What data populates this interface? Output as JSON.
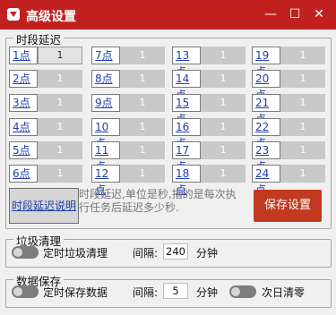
{
  "window": {
    "title": "高级设置",
    "min_symbol": "—",
    "max_symbol": "☐",
    "close_symbol": "✕"
  },
  "delay_group": {
    "legend": "时段延迟",
    "hours": [
      {
        "label": "1点",
        "value": "1"
      },
      {
        "label": "2点",
        "value": "1"
      },
      {
        "label": "3点",
        "value": "1"
      },
      {
        "label": "4点",
        "value": "1"
      },
      {
        "label": "5点",
        "value": "1"
      },
      {
        "label": "6点",
        "value": "1"
      },
      {
        "label": "7点",
        "value": "1"
      },
      {
        "label": "8点",
        "value": "1"
      },
      {
        "label": "9点",
        "value": "1"
      },
      {
        "label": "10点",
        "value": "1"
      },
      {
        "label": "11点",
        "value": "1"
      },
      {
        "label": "12点",
        "value": "1"
      },
      {
        "label": "13点",
        "value": "1"
      },
      {
        "label": "14点",
        "value": "1"
      },
      {
        "label": "15点",
        "value": "1"
      },
      {
        "label": "16点",
        "value": "1"
      },
      {
        "label": "17点",
        "value": "1"
      },
      {
        "label": "18点",
        "value": "1"
      },
      {
        "label": "19点",
        "value": "1"
      },
      {
        "label": "20点",
        "value": "1"
      },
      {
        "label": "21点",
        "value": "1"
      },
      {
        "label": "22点",
        "value": "1"
      },
      {
        "label": "23点",
        "value": "1"
      },
      {
        "label": "24点",
        "value": "1"
      }
    ],
    "explain_button": "时段延迟说明",
    "explain_text": "时段延迟,单位是秒,指的是每次执行任务后延迟多少秒.",
    "save_button": "保存设置"
  },
  "trash_group": {
    "legend": "垃圾清理",
    "toggle_label": "定时垃圾清理",
    "interval_label": "间隔:",
    "interval_value": "240",
    "unit": "分钟"
  },
  "save_group": {
    "legend": "数据保存",
    "toggle_label": "定时保存数据",
    "interval_label": "间隔:",
    "interval_value": "5",
    "unit": "分钟",
    "clear_label": "次日清零"
  },
  "colors": {
    "titlebar": "#c0211f",
    "save_button": "#c13a1f",
    "link_text": "#1f3fa8"
  }
}
